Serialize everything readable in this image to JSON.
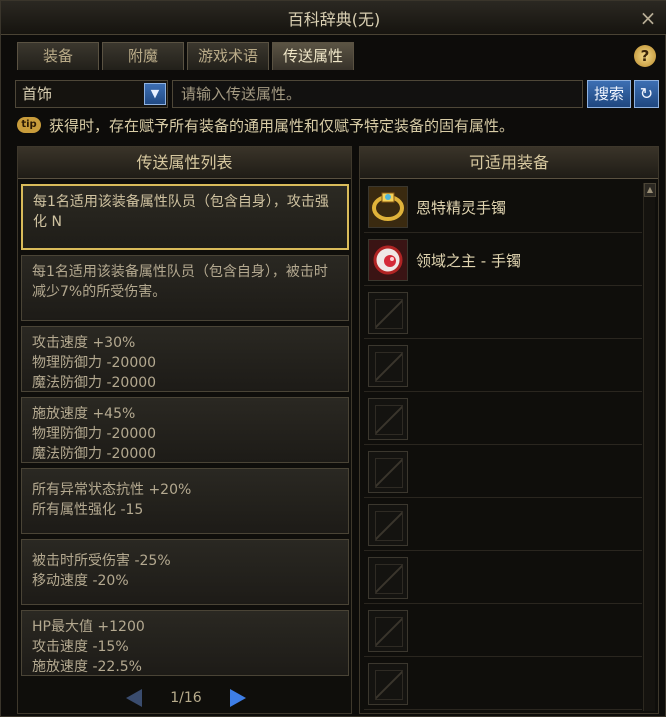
{
  "window": {
    "title": "百科辞典(无)",
    "close_label": "×"
  },
  "tabs": [
    {
      "label": "装备",
      "active": false
    },
    {
      "label": "附魔",
      "active": false
    },
    {
      "label": "游戏术语",
      "active": false
    },
    {
      "label": "传送属性",
      "active": true
    }
  ],
  "help_label": "?",
  "filter": {
    "category_selected": "首饰",
    "search_placeholder": "请输入传送属性。",
    "search_label": "搜索",
    "refresh_icon": "refresh-icon"
  },
  "tip": {
    "badge": "tip",
    "text": "获得时，存在赋予所有装备的通用属性和仅赋予特定装备的固有属性。"
  },
  "attribute_list": {
    "header": "传送属性列表",
    "items": [
      {
        "lines": [
          "每1名适用该装备属性队员（包含自身），攻击强化 N"
        ],
        "selected": true
      },
      {
        "lines": [
          "每1名适用该装备属性队员（包含自身），被击时减少7%的所受伤害。"
        ],
        "selected": false
      },
      {
        "lines": [
          "攻击速度 +30%",
          "物理防御力 -20000",
          "魔法防御力 -20000"
        ],
        "selected": false
      },
      {
        "lines": [
          "施放速度 +45%",
          "物理防御力 -20000",
          "魔法防御力 -20000"
        ],
        "selected": false
      },
      {
        "lines": [
          "所有异常状态抗性 +20%",
          "所有属性强化 -15"
        ],
        "selected": false
      },
      {
        "lines": [
          "被击时所受伤害 -25%",
          "移动速度 -20%"
        ],
        "selected": false
      },
      {
        "lines": [
          "HP最大值 +1200",
          "攻击速度 -15%",
          "施放速度 -22.5%"
        ],
        "selected": false
      }
    ],
    "pager": {
      "text": "1/16"
    }
  },
  "equipment": {
    "header": "可适用装备",
    "items": [
      {
        "name": "恩特精灵手镯",
        "icon": "bracelet-gold-icon"
      },
      {
        "name": "领域之主 - 手镯",
        "icon": "bracelet-red-orb-icon"
      },
      {
        "name": "",
        "icon": "empty-slot-icon"
      },
      {
        "name": "",
        "icon": "empty-slot-icon"
      },
      {
        "name": "",
        "icon": "empty-slot-icon"
      },
      {
        "name": "",
        "icon": "empty-slot-icon"
      },
      {
        "name": "",
        "icon": "empty-slot-icon"
      },
      {
        "name": "",
        "icon": "empty-slot-icon"
      },
      {
        "name": "",
        "icon": "empty-slot-icon"
      },
      {
        "name": "",
        "icon": "empty-slot-icon"
      }
    ]
  }
}
